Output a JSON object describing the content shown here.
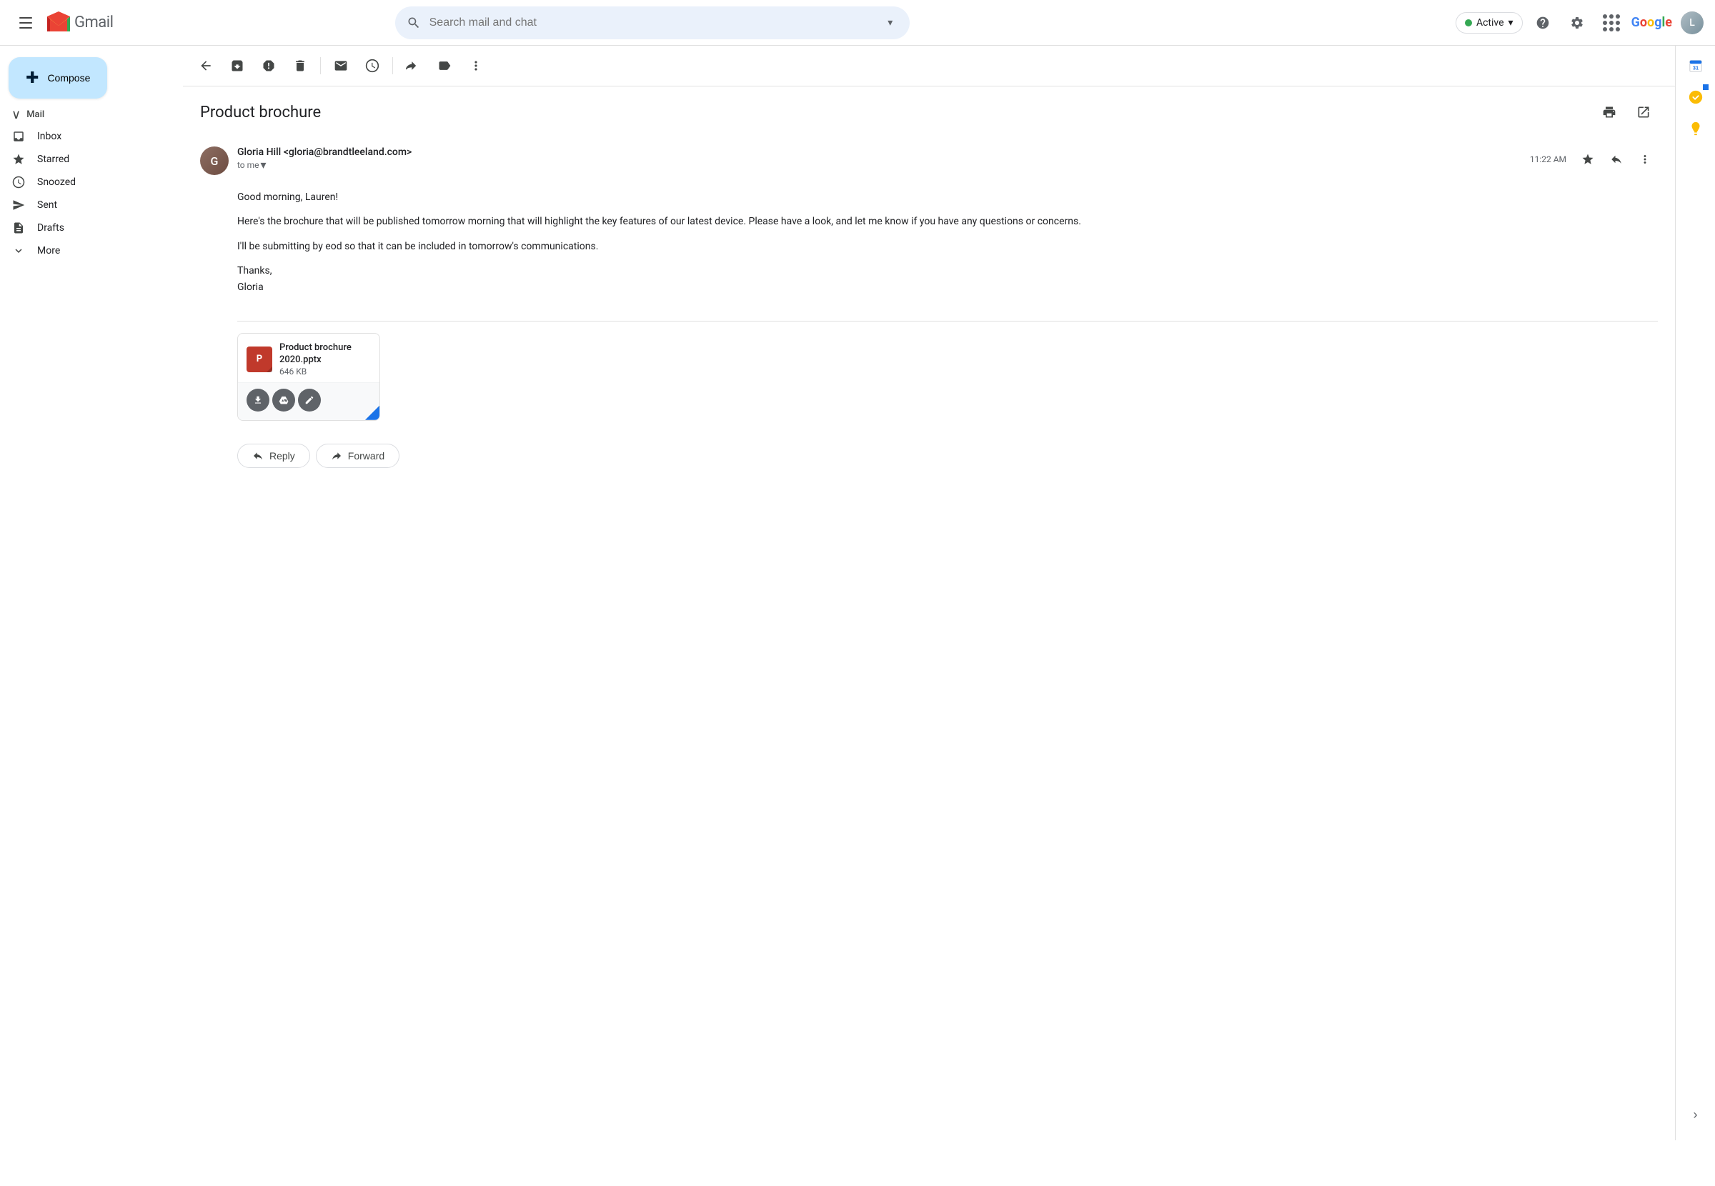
{
  "app": {
    "title": "Gmail",
    "logo_text": "Gmail"
  },
  "search": {
    "placeholder": "Search mail and chat"
  },
  "status": {
    "label": "Active",
    "dot_color": "#34a853"
  },
  "sidebar": {
    "compose_label": "Compose",
    "mail_section_label": "Mail",
    "nav_items": [
      {
        "id": "inbox",
        "label": "Inbox",
        "icon": "☰"
      },
      {
        "id": "starred",
        "label": "Starred",
        "icon": "☆"
      },
      {
        "id": "snoozed",
        "label": "Snoozed",
        "icon": "◷"
      },
      {
        "id": "sent",
        "label": "Sent",
        "icon": "▷"
      },
      {
        "id": "drafts",
        "label": "Drafts",
        "icon": "📄"
      },
      {
        "id": "more",
        "label": "More",
        "icon": "∨"
      }
    ]
  },
  "email": {
    "subject": "Product brochure",
    "sender_name": "Gloria Hill",
    "sender_email": "gloria@brandtleeland.com",
    "sender_email_full": "Gloria Hill <gloria@brandtleeland.com>",
    "to_me_label": "to me",
    "time": "11:22 AM",
    "body_lines": [
      "Good morning, Lauren!",
      "",
      "Here's the brochure that will be published tomorrow morning that will highlight the key features of our latest device. Please have a look, and let me know if you have any questions or concerns.",
      "",
      "I'll be submitting by eod so that it can be included in tomorrow's communications.",
      "",
      "Thanks,",
      "Gloria"
    ],
    "attachment": {
      "name": "Product brochure 2020.pptx",
      "name_line1": "Product brochure",
      "name_line2": "2020.pptx",
      "size": "646 KB",
      "type_label": "P"
    },
    "reply_label": "Reply",
    "forward_label": "Forward"
  },
  "icons": {
    "back": "←",
    "archive": "⬦",
    "report_spam": "⚠",
    "delete": "🗑",
    "mark_unread": "✉",
    "snooze": "◷",
    "move_to": "→",
    "label": "🏷",
    "more_vert": "⋮",
    "print": "🖨",
    "new_window": "⛶",
    "star": "☆",
    "reply": "↩",
    "download": "⬇",
    "drive_upload": "⬆",
    "edit": "✎",
    "reply_arrow": "↩",
    "forward_arrow": "↪",
    "chevron_right": "›",
    "question": "?",
    "gear": "⚙",
    "apps_grid": "⊞"
  }
}
